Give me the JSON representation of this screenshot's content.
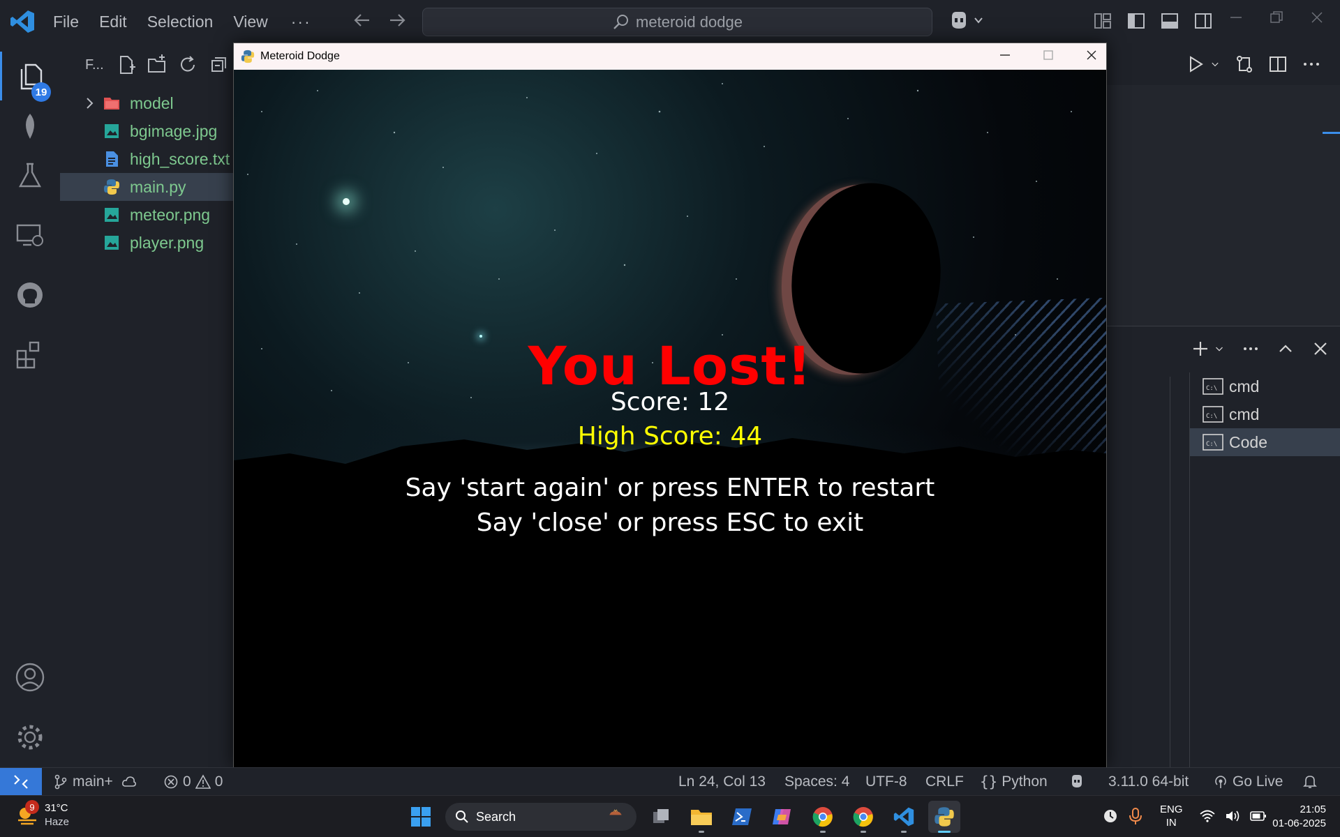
{
  "titlebar": {
    "menu": [
      "File",
      "Edit",
      "Selection",
      "View"
    ],
    "more": "···",
    "search_text": "meteroid dodge"
  },
  "activity": {
    "explorer_badge": "19"
  },
  "explorer": {
    "header": "F...",
    "items": [
      {
        "label": "model",
        "type": "folder",
        "color": "#e05252"
      },
      {
        "label": "bgimage.jpg",
        "type": "image",
        "color": "#26a69a"
      },
      {
        "label": "high_score.txt",
        "type": "text",
        "color": "#4a90e2"
      },
      {
        "label": "main.py",
        "type": "python",
        "color": "#f2c94c"
      },
      {
        "label": "meteor.png",
        "type": "image",
        "color": "#26a69a"
      },
      {
        "label": "player.png",
        "type": "image",
        "color": "#26a69a"
      }
    ]
  },
  "terminals": [
    {
      "label": "cmd",
      "active": false
    },
    {
      "label": "cmd",
      "active": false
    },
    {
      "label": "Code",
      "active": true
    }
  ],
  "game": {
    "window_title": "Meteroid Dodge",
    "lost": "You Lost!",
    "score": "Score: 12",
    "high_score": "High Score: 44",
    "instruction_restart": "Say 'start again' or press ENTER to restart",
    "instruction_exit": "Say 'close' or press ESC to exit",
    "colors": {
      "lost": "#ff0000",
      "high_score": "#ffff00",
      "text": "#ffffff"
    }
  },
  "statusbar": {
    "branch": "main+",
    "errors": "0",
    "warnings": "0",
    "position": "Ln 24, Col 13",
    "spaces": "Spaces: 4",
    "encoding": "UTF-8",
    "eol": "CRLF",
    "language": "Python",
    "interpreter": "3.11.0 64-bit",
    "golive": "Go Live"
  },
  "taskbar": {
    "weather_badge": "9",
    "temperature": "31°C",
    "condition": "Haze",
    "search": "Search",
    "lang_line1": "ENG",
    "lang_line2": "IN",
    "time": "21:05",
    "date": "01-06-2025"
  }
}
